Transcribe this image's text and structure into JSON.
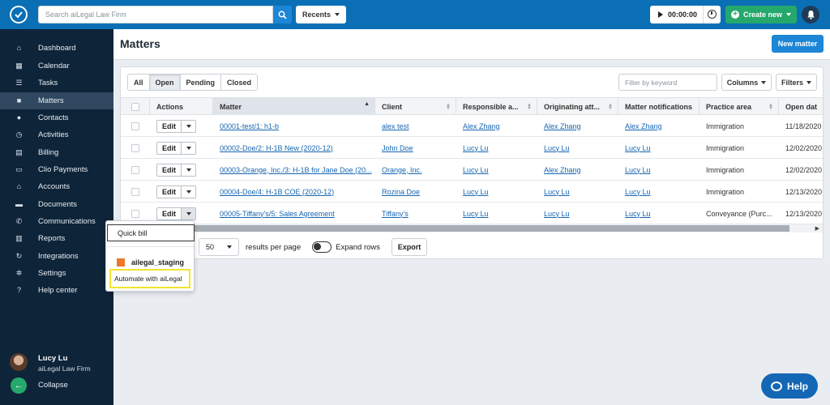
{
  "topbar": {
    "search_placeholder": "Search aiLegal Law Firm",
    "recents_label": "Recents",
    "timer_value": "00:00:00",
    "create_new_label": "Create new"
  },
  "sidebar": {
    "items": [
      {
        "label": "Dashboard",
        "icon": "home-icon"
      },
      {
        "label": "Calendar",
        "icon": "calendar-icon"
      },
      {
        "label": "Tasks",
        "icon": "tasks-icon"
      },
      {
        "label": "Matters",
        "icon": "briefcase-icon"
      },
      {
        "label": "Contacts",
        "icon": "person-icon"
      },
      {
        "label": "Activities",
        "icon": "clock-icon"
      },
      {
        "label": "Billing",
        "icon": "billing-icon"
      },
      {
        "label": "Clio Payments",
        "icon": "card-icon"
      },
      {
        "label": "Accounts",
        "icon": "bank-icon"
      },
      {
        "label": "Documents",
        "icon": "folder-icon"
      },
      {
        "label": "Communications",
        "icon": "phone-icon"
      },
      {
        "label": "Reports",
        "icon": "chart-icon"
      },
      {
        "label": "Integrations",
        "icon": "sync-icon"
      },
      {
        "label": "Settings",
        "icon": "gear-icon"
      },
      {
        "label": "Help center",
        "icon": "question-icon"
      }
    ],
    "active_item": "Matters",
    "user": {
      "name": "Lucy Lu",
      "firm": "aiLegal Law Firm"
    },
    "collapse_label": "Collapse"
  },
  "page": {
    "title": "Matters",
    "new_matter_label": "New matter"
  },
  "filters": {
    "tabs": [
      "All",
      "Open",
      "Pending",
      "Closed"
    ],
    "active_tab": "Open",
    "keyword_placeholder": "Filter by keyword",
    "columns_label": "Columns",
    "filters_label": "Filters"
  },
  "table": {
    "headers": [
      "Actions",
      "Matter",
      "Client",
      "Responsible a...",
      "Originating att...",
      "Matter notifications",
      "Practice area",
      "Open dat"
    ],
    "sorted_column": "Matter",
    "edit_label": "Edit",
    "rows": [
      {
        "matter": "00001-test/1: h1-b",
        "client": "alex test",
        "responsible": "Alex Zhang",
        "originating": "Alex Zhang",
        "notifications": "Alex Zhang",
        "practice_area": "Immigration",
        "open_date": "11/18/2020"
      },
      {
        "matter": "00002-Doe/2: H-1B New (2020-12)",
        "client": "John Doe",
        "responsible": "Lucy Lu",
        "originating": "Lucy Lu",
        "notifications": "Lucy Lu",
        "practice_area": "Immigration",
        "open_date": "12/02/2020"
      },
      {
        "matter": "00003-Orange, Inc./3: H-1B for Jane Doe (20...",
        "client": "Orange, Inc.",
        "responsible": "Lucy Lu",
        "originating": "Alex Zhang",
        "notifications": "Lucy Lu",
        "practice_area": "Immigration",
        "open_date": "12/02/2020"
      },
      {
        "matter": "00004-Doe/4: H-1B COE (2020-12)",
        "client": "Rozina Doe",
        "responsible": "Lucy Lu",
        "originating": "Lucy Lu",
        "notifications": "Lucy Lu",
        "practice_area": "Immigration",
        "open_date": "12/13/2020"
      },
      {
        "matter": "00005-Tiffany's/5: Sales Agreement",
        "client": "Tiffany's",
        "responsible": "Lucy Lu",
        "originating": "Lucy Lu",
        "notifications": "Lucy Lu",
        "practice_area": "Conveyance (Purc...",
        "open_date": "12/13/2020"
      }
    ]
  },
  "pagination": {
    "per_page_value": "50",
    "per_page_label": "results per page",
    "expand_rows_label": "Expand rows",
    "export_label": "Export"
  },
  "dropdown": {
    "quick_bill_label": "Quick bill",
    "app_name": "ailegal_staging",
    "automate_label": "Automate with aiLegal"
  },
  "help": {
    "label": "Help"
  },
  "colors": {
    "topbar": "#0a6fb5",
    "sidebar": "#0e2439",
    "accent": "#1d86d6",
    "create": "#25a86c",
    "highlight": "#f2e52b"
  }
}
